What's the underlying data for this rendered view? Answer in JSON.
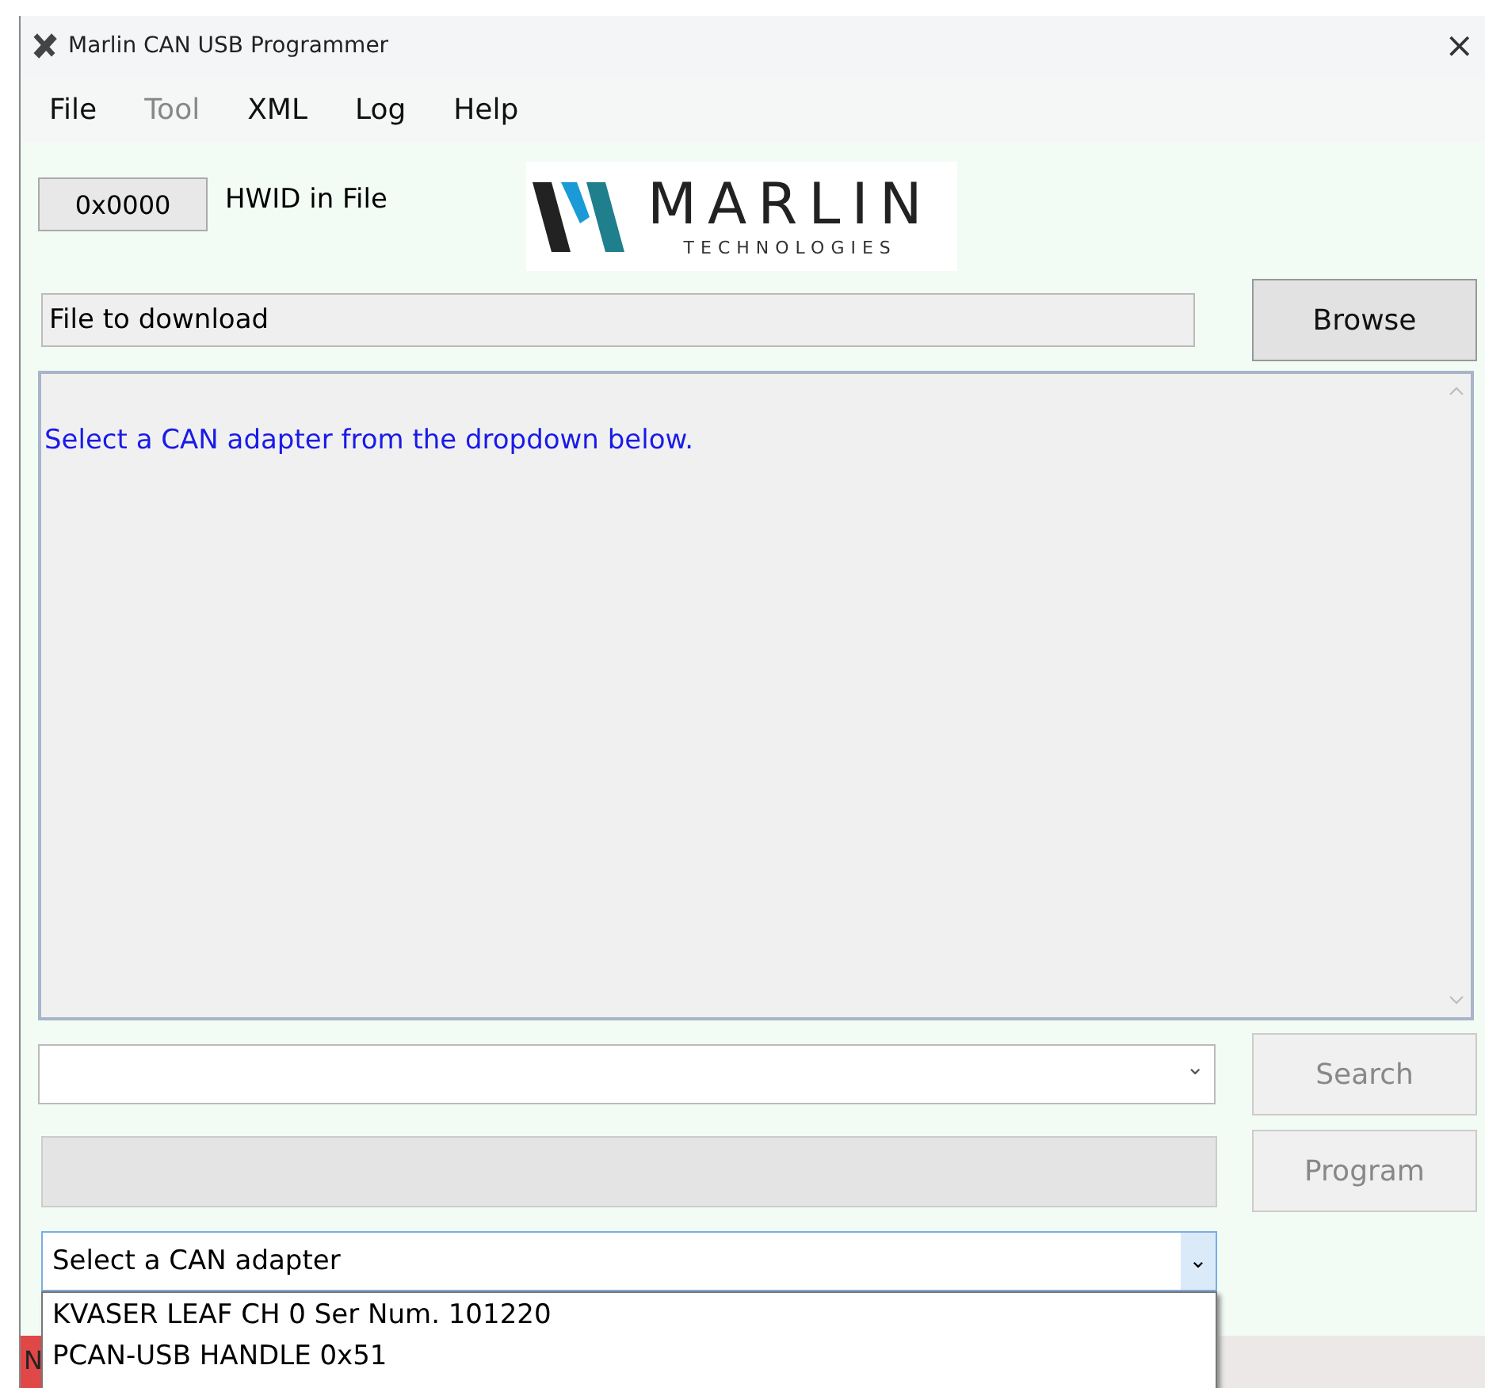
{
  "window": {
    "title": "Marlin CAN USB Programmer",
    "close": "×"
  },
  "menu": [
    {
      "label": "File",
      "disabled": false
    },
    {
      "label": "Tool",
      "disabled": true
    },
    {
      "label": "XML",
      "disabled": false
    },
    {
      "label": "Log",
      "disabled": false
    },
    {
      "label": "Help",
      "disabled": false
    }
  ],
  "hwid": {
    "value": "0x0000",
    "label": "HWID in File"
  },
  "logo": {
    "name": "MARLIN",
    "tagline": "TECHNOLOGIES"
  },
  "file_field": {
    "value": "File to download"
  },
  "browse_button": {
    "label": "Browse",
    "disabled": false
  },
  "log": {
    "message": "Select a CAN adapter from the dropdown below."
  },
  "device_combo": {
    "caret": "⌄"
  },
  "search_button": {
    "label": "Search",
    "disabled": true
  },
  "progress": {
    "level": 0
  },
  "program_button": {
    "label": "Program",
    "disabled": true
  },
  "adapter_combo": {
    "value": "Select a CAN adapter",
    "caret": "⌄",
    "expanded": true,
    "options": [
      "KVASER LEAF CH 0 Ser Num. 101220",
      "PCAN-USB HANDLE 0x51"
    ]
  },
  "status_bar": {
    "text": "N"
  }
}
